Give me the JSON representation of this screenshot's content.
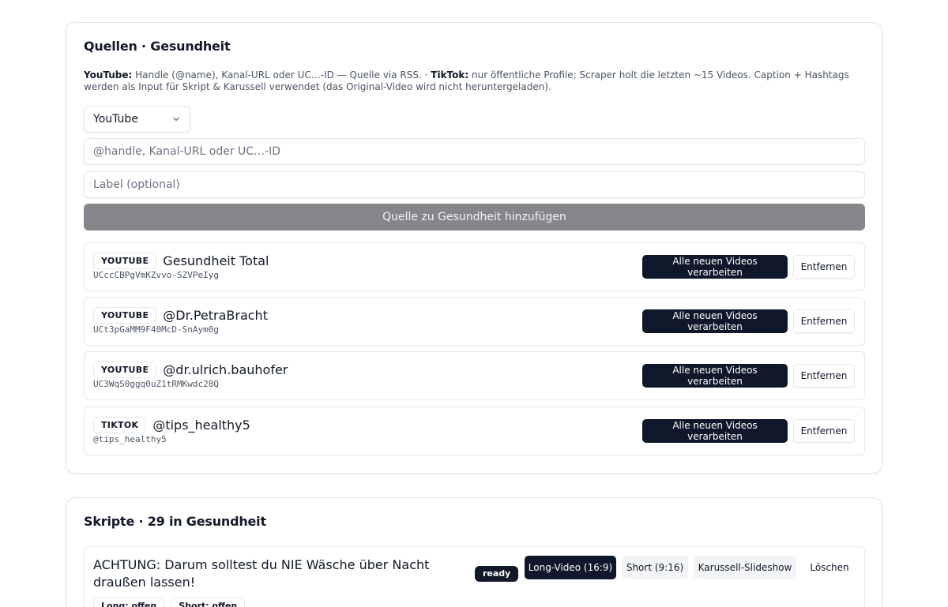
{
  "sources": {
    "title": "Quellen · Gesundheit",
    "help": {
      "youtube_label": "YouTube:",
      "youtube_text": " Handle (@name), Kanal-URL oder UC…-ID — Quelle via RSS. · ",
      "tiktok_label": "TikTok:",
      "tiktok_text": " nur öffentliche Profile; Scraper holt die letzten ~15 Videos. Caption + Hashtags werden als Input für Skript & Karussell verwendet (das Original-Video wird nicht heruntergeladen)."
    },
    "platform_select": {
      "value": "YouTube"
    },
    "handle_input": {
      "placeholder": "@handle, Kanal-URL oder UC…-ID",
      "value": ""
    },
    "label_input": {
      "placeholder": "Label (optional)",
      "value": ""
    },
    "add_button": "Quelle zu Gesundheit hinzufügen",
    "items": [
      {
        "platform": "YOUTUBE",
        "name": "Gesundheit Total",
        "id": "UCccCBPgVmKZvvo-SZVPeIyg",
        "process_label": "Alle neuen Videos verarbeiten",
        "remove_label": "Entfernen"
      },
      {
        "platform": "YOUTUBE",
        "name": "@Dr.PetraBracht",
        "id": "UCt3pGaMM9F40McD-SnAym0g",
        "process_label": "Alle neuen Videos verarbeiten",
        "remove_label": "Entfernen"
      },
      {
        "platform": "YOUTUBE",
        "name": "@dr.ulrich.bauhofer",
        "id": "UC3WqS0ggq0uZ1tRMKwdc28Q",
        "process_label": "Alle neuen Videos verarbeiten",
        "remove_label": "Entfernen"
      },
      {
        "platform": "TIKTOK",
        "name": "@tips_healthy5",
        "id": "@tips_healthy5",
        "process_label": "Alle neuen Videos verarbeiten",
        "remove_label": "Entfernen"
      }
    ]
  },
  "scripts": {
    "title": "Skripte · 29 in Gesundheit",
    "items": [
      {
        "title": "ACHTUNG: Darum solltest du NIE Wäsche über Nacht draußen lassen!",
        "status": "ready",
        "long_label": "Long-Video (16:9)",
        "short_label": "Short (9:16)",
        "carousel_label": "Karussell-Slideshow",
        "delete_label": "Löschen",
        "chip_long": "Long: offen",
        "chip_short": "Short: offen"
      }
    ]
  },
  "colors": {
    "primary_dark": "#0f172a",
    "disabled_button": "#85868a",
    "border": "#e5e7eb"
  }
}
